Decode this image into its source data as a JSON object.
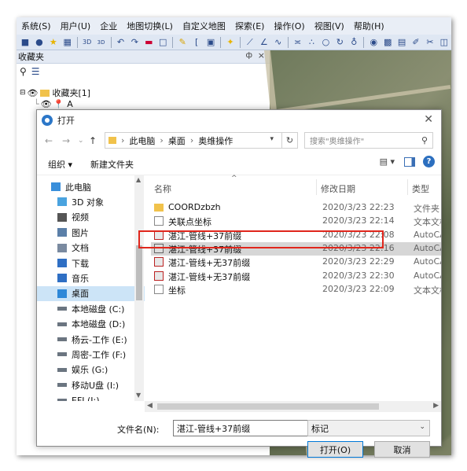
{
  "menu": [
    "系统(S)",
    "用户(U)",
    "企业",
    "地图切换(L)",
    "自定义地图",
    "探索(E)",
    "操作(O)",
    "视图(V)",
    "帮助(H)"
  ],
  "favorites": {
    "title": "收藏夹",
    "pin": "ф",
    "close": "×",
    "root": "收藏夹[1]",
    "child": "A"
  },
  "dialog": {
    "title": "打开",
    "path": [
      "此电脑",
      "桌面",
      "奥维操作"
    ],
    "search_placeholder": "搜索\"奥维操作\"",
    "organize": "组织 ▾",
    "new_folder": "新建文件夹",
    "nav_items": [
      {
        "label": "此电脑",
        "icon": "pc-icon"
      },
      {
        "label": "3D 对象",
        "icon": "3d-objects-icon"
      },
      {
        "label": "视频",
        "icon": "video-icon"
      },
      {
        "label": "图片",
        "icon": "pictures-icon"
      },
      {
        "label": "文档",
        "icon": "documents-icon"
      },
      {
        "label": "下载",
        "icon": "downloads-icon"
      },
      {
        "label": "音乐",
        "icon": "music-icon"
      },
      {
        "label": "桌面",
        "icon": "desktop-icon"
      },
      {
        "label": "本地磁盘 (C:)",
        "icon": "drive-icon"
      },
      {
        "label": "本地磁盘 (D:)",
        "icon": "drive-icon"
      },
      {
        "label": "杨云-工作 (E:)",
        "icon": "drive-icon"
      },
      {
        "label": "周密-工作 (F:)",
        "icon": "drive-icon"
      },
      {
        "label": "娱乐 (G:)",
        "icon": "drive-icon"
      },
      {
        "label": "移动U盘 (I:)",
        "icon": "usb-drive-icon"
      },
      {
        "label": "EFI (J:)",
        "icon": "drive-icon"
      }
    ],
    "columns": {
      "name": "名称",
      "date": "修改日期",
      "type": "类型"
    },
    "files": [
      {
        "name": "COORDzbzh",
        "date": "2020/3/23 22:23",
        "type": "文件夹",
        "icon": "folder-icon"
      },
      {
        "name": "关联点坐标",
        "date": "2020/3/23 22:14",
        "type": "文本文档",
        "icon": "text-file-icon"
      },
      {
        "name": "湛江-管线+37前缀",
        "date": "2020/3/23 22:08",
        "type": "AutoCAD",
        "icon": "autocad-file-icon"
      },
      {
        "name": "湛江-管线+37前缀",
        "date": "2020/3/23 22:16",
        "type": "AutoCAD",
        "icon": "autocad-dxf-icon"
      },
      {
        "name": "湛江-管线+无37前缀",
        "date": "2020/3/23 22:29",
        "type": "AutoCAD",
        "icon": "autocad-file-icon"
      },
      {
        "name": "湛江-管线+无37前缀",
        "date": "2020/3/23 22:30",
        "type": "AutoCAD",
        "icon": "autocad-file-icon"
      },
      {
        "name": "坐标",
        "date": "2020/3/23 22:09",
        "type": "文本文档",
        "icon": "text-file-icon"
      }
    ],
    "selected_file_index": 3,
    "filename_label": "文件名(N):",
    "filename_value": "湛江-管线+37前缀",
    "filter_value": "标记",
    "open_button": "打开(O)",
    "cancel_button": "取消"
  },
  "colors": {
    "selection": "#d6d6d6",
    "highlight_box": "#e0261c",
    "nav_selected": "#cce4f7"
  }
}
